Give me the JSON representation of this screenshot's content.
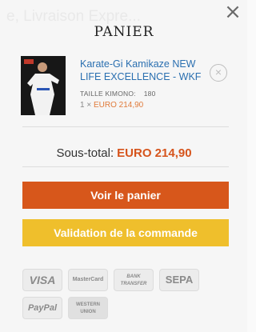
{
  "background": {
    "hint_text": "e, Livraison Expre..."
  },
  "cart": {
    "title": "PANIER",
    "item": {
      "name": "Karate-Gi Kamikaze NEW LIFE EXCELLENCE - WKF",
      "attribute_label": "TAILLE KIMONO:",
      "attribute_value": "180",
      "quantity": "1 ×",
      "price": "EURO 214,90",
      "remove_symbol": "×"
    },
    "subtotal_label": "Sous-total:",
    "subtotal_value": "EURO 214,90",
    "view_cart_label": "Voir le panier",
    "checkout_label": "Validation de la commande",
    "close_symbol": "×"
  },
  "payments": [
    {
      "name": "VISA"
    },
    {
      "name": "MasterCard"
    },
    {
      "name": "BANK TRANSFER"
    },
    {
      "name": "SEPA"
    },
    {
      "name": "PayPal"
    },
    {
      "name": "WESTERN UNION"
    }
  ],
  "colors": {
    "link": "#2a6fb0",
    "price": "#e07b3b",
    "subtotal_amount": "#d6541c",
    "view_button": "#d7571b",
    "checkout_button": "#efbf2c"
  }
}
